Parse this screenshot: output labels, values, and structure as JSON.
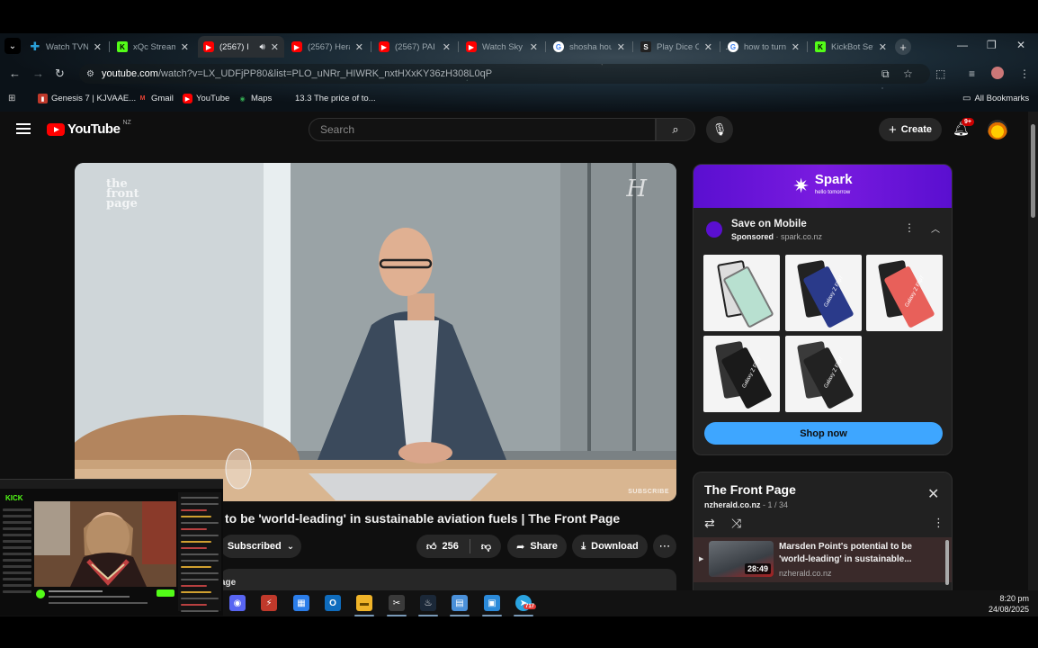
{
  "browser": {
    "tabs": [
      {
        "title": "Watch TVN",
        "favicon": "plus-icon",
        "color": "#2aa0d8",
        "active": false
      },
      {
        "title": "xQc Stream",
        "favicon": "kick-icon",
        "color": "#53fc18",
        "active": false
      },
      {
        "title": "(2567) I",
        "favicon": "youtube-icon",
        "color": "#ff0000",
        "active": true,
        "audio": true
      },
      {
        "title": "(2567) Hera",
        "favicon": "youtube-icon",
        "color": "#ff0000",
        "active": false
      },
      {
        "title": "(2567) PAI",
        "favicon": "youtube-icon",
        "color": "#ff0000",
        "active": false
      },
      {
        "title": "Watch Sky",
        "favicon": "youtube-icon",
        "color": "#ff0000",
        "active": false
      },
      {
        "title": "shosha hou",
        "favicon": "google-icon",
        "color": "#ffffff",
        "active": false
      },
      {
        "title": "Play Dice C",
        "favicon": "stake-icon",
        "color": "#222222",
        "active": false
      },
      {
        "title": "how to turn",
        "favicon": "google-icon",
        "color": "#ffffff",
        "active": false
      },
      {
        "title": "KickBot Set",
        "favicon": "kick-icon",
        "color": "#53fc18",
        "active": false
      }
    ],
    "url_domain": "youtube.com",
    "url_path": "/watch?v=LX_UDFjPP80&list=PLO_uNRr_HIWRK_nxtHXxKY36zH308L0qP",
    "bookmarks": [
      {
        "label": "Genesis 7 | KJVAAE...",
        "icon": "bible-icon",
        "color": "#c0392b"
      },
      {
        "label": "Gmail",
        "icon": "gmail-icon",
        "color": "#ea4335"
      },
      {
        "label": "YouTube",
        "icon": "youtube-icon",
        "color": "#ff0000"
      },
      {
        "label": "Maps",
        "icon": "maps-icon",
        "color": "#34a853"
      },
      {
        "label": "13.3 The price of to...",
        "icon": "",
        "color": ""
      }
    ],
    "all_bookmarks_label": "All Bookmarks"
  },
  "youtube": {
    "logo_text": "YouTube",
    "region": "NZ",
    "search_placeholder": "Search",
    "create_label": "Create",
    "notification_count": "9+",
    "video": {
      "overlay_brand": "the\nfront\npage",
      "overlay_logo": "H",
      "overlay_subscribe": "SUBSCRIBE",
      "title_visible": "to be 'world-leading' in sustainable aviation fuels | The Front Page",
      "subscribed_label": "Subscribed",
      "likes": "256",
      "share_label": "Share",
      "download_label": "Download",
      "description_fragment": "age"
    },
    "ad": {
      "banner_brand": "Spark",
      "banner_tagline": "hello tomorrow",
      "title": "Save on Mobile",
      "sponsored_label": "Sponsored",
      "advertiser": "spark.co.nz",
      "products": [
        {
          "label": "",
          "color": "#b8e0d0"
        },
        {
          "label": "Galaxy Z Flip7",
          "color": "#2a3a8a"
        },
        {
          "label": "Galaxy Z Flip7",
          "color": "#e8605a"
        },
        {
          "label": "Galaxy Z Flip7",
          "color": "#1a1a1a"
        },
        {
          "label": "Galaxy Z Flip7",
          "color": "#222222"
        }
      ],
      "cta": "Shop now"
    },
    "playlist": {
      "title": "The Front Page",
      "channel": "nzherald.co.nz",
      "position": "1 / 34",
      "current_item": {
        "title": "Marsden Point's potential to be 'world-leading' in sustainable...",
        "duration": "28:49",
        "channel": "nzherald.co.nz"
      }
    }
  },
  "taskbar": {
    "apps": [
      {
        "name": "discord-icon",
        "color": "#5865f2",
        "glyph": "◉"
      },
      {
        "name": "flash-icon",
        "color": "#c0392b",
        "glyph": "⚡"
      },
      {
        "name": "store-icon",
        "color": "#2b7de9",
        "glyph": "▦"
      },
      {
        "name": "outlook-icon",
        "color": "#0f6cbd",
        "glyph": "O"
      },
      {
        "name": "file-explorer-icon",
        "color": "#f0b429",
        "glyph": "▬"
      },
      {
        "name": "snipping-tool-icon",
        "color": "#3a3a3a",
        "glyph": "✂"
      },
      {
        "name": "steam-icon",
        "color": "#1b2838",
        "glyph": "♨"
      },
      {
        "name": "notepad-icon",
        "color": "#4a90d9",
        "glyph": "▤"
      },
      {
        "name": "app-icon",
        "color": "#2b8ad9",
        "glyph": "▣"
      },
      {
        "name": "telegram-icon",
        "color": "#2aa3e0",
        "glyph": "➤"
      }
    ],
    "telegram_badge": "717",
    "time": "8:20 pm",
    "date": "24/08/2025"
  },
  "stream_overlay": {
    "brand": "KICK"
  }
}
